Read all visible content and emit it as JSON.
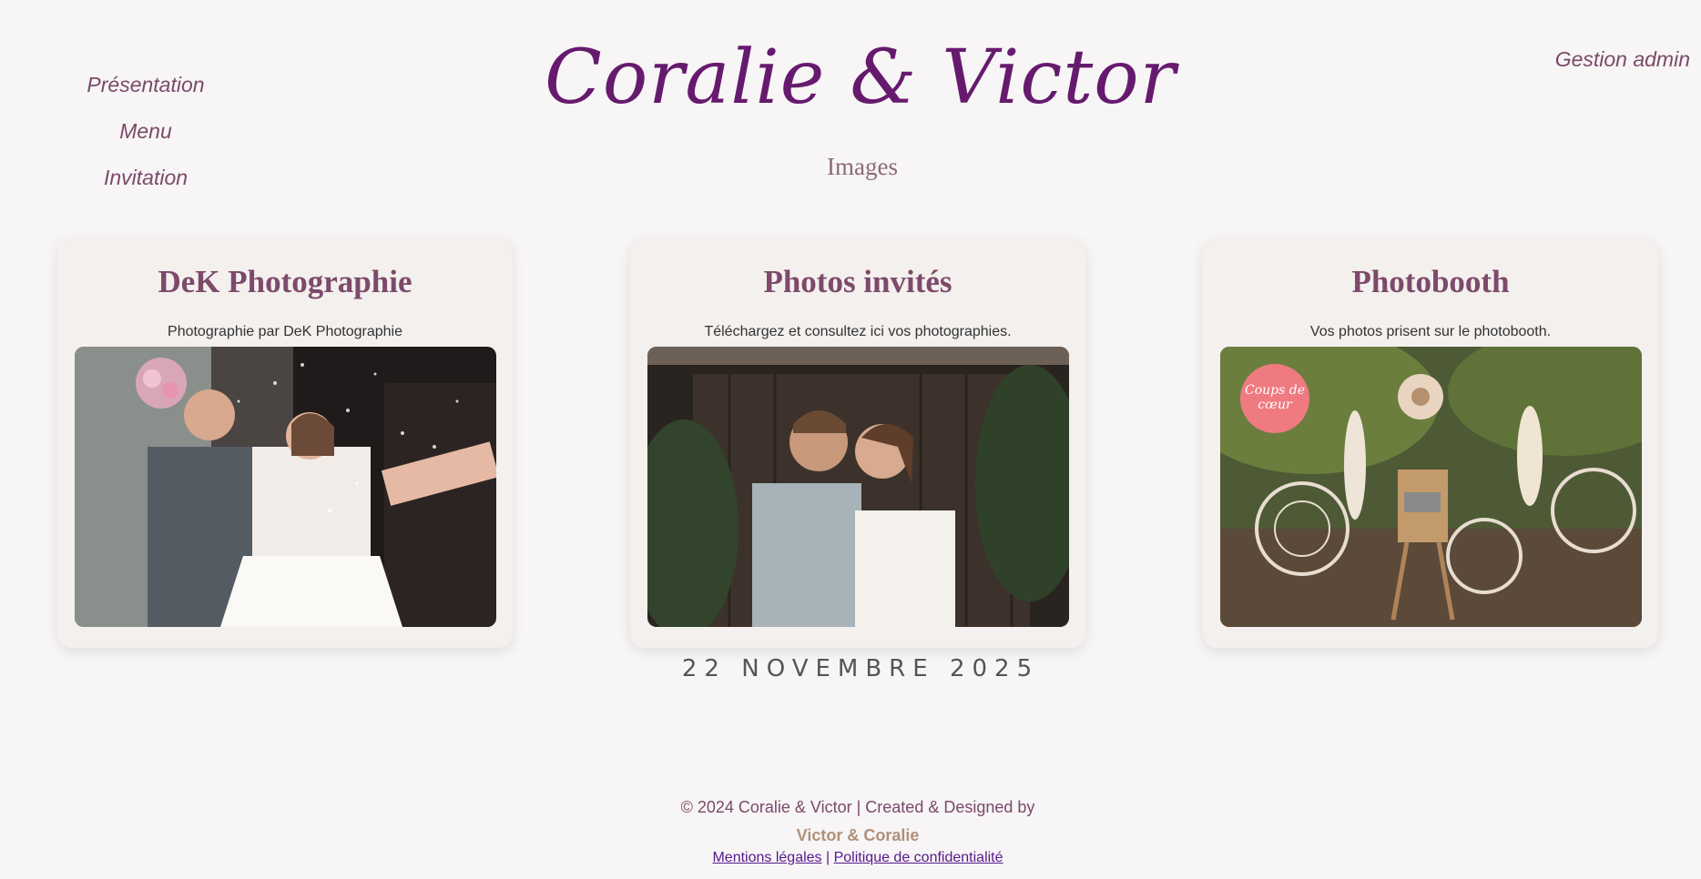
{
  "nav": {
    "items": [
      {
        "label": "Présentation"
      },
      {
        "label": "Menu"
      },
      {
        "label": "Invitation"
      }
    ],
    "admin_label": "Gestion admin"
  },
  "header": {
    "title": "Coralie & Victor",
    "subtitle": "Images"
  },
  "cards": [
    {
      "title": "DeK Photographie",
      "description": "Photographie par DeK Photographie",
      "image": "wedding-confetti-photo"
    },
    {
      "title": "Photos invités",
      "description": "Téléchargez et consultez ici vos photographies.",
      "image": "couple-kiss-photo"
    },
    {
      "title": "Photobooth",
      "description": "Vos photos prisent sur le photobooth.",
      "image": "photobooth-dreamcatchers-photo",
      "badge": "Coups de cœur"
    }
  ],
  "date": "22 NOVEMBRE 2025",
  "footer": {
    "copyright": "© 2024 Coralie & Victor | Created & Designed by",
    "designers": "Victor & Coralie",
    "separator": "|",
    "links": [
      {
        "label": "Mentions légales"
      },
      {
        "label": "Politique de confidentialité"
      }
    ]
  },
  "colors": {
    "title": "#661a6e",
    "nav": "#7a4a6a",
    "card_title": "#7d4a6b",
    "background": "#f7f5f5"
  }
}
